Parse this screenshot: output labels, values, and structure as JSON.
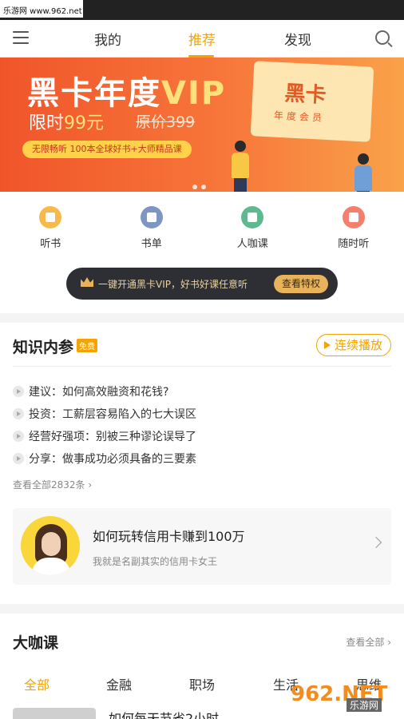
{
  "watermark": {
    "top_left": "乐游网 www.962.net",
    "bottom_right_logo": "962.NET",
    "bottom_right_text": "乐游网"
  },
  "nav": {
    "tabs": [
      "我的",
      "推荐",
      "发现"
    ],
    "active_index": 1
  },
  "banner": {
    "title_main": "黑卡年度",
    "title_vip": "VIP",
    "price_prefix": "限时",
    "price_value": "99元",
    "original_price": "原价399",
    "pill": "无限畅听 100本全球好书+大师精品课",
    "card_title": "黑卡",
    "card_sub": "年度会员",
    "page_count": 2
  },
  "quick_links": [
    {
      "label": "听书",
      "color": "#f8b84a"
    },
    {
      "label": "书单",
      "color": "#7f95c2"
    },
    {
      "label": "人咖课",
      "color": "#5fb98f"
    },
    {
      "label": "随时听",
      "color": "#f47f6d"
    }
  ],
  "vip_bar": {
    "text": "一键开通黑卡VIP，好书好课任意听",
    "button": "查看特权"
  },
  "zhishi": {
    "title": "知识内参",
    "badge": "免费",
    "play_button": "连续播放",
    "items": [
      "建议：如何高效融资和花钱?",
      "投资：工薪层容易陷入的七大误区",
      "经营好强项：别被三种谬论误导了",
      "分享：做事成功必须具备的三要素"
    ],
    "more": "查看全部2832条",
    "feature": {
      "title": "如何玩转信用卡赚到100万",
      "subtitle": "我就是名副其实的信用卡女王"
    }
  },
  "dakeke": {
    "title": "大咖课",
    "more": "查看全部",
    "categories": [
      "全部",
      "金融",
      "职场",
      "生活",
      "思维"
    ],
    "active_index": 0,
    "first_title": "如何每天节省2小时"
  }
}
